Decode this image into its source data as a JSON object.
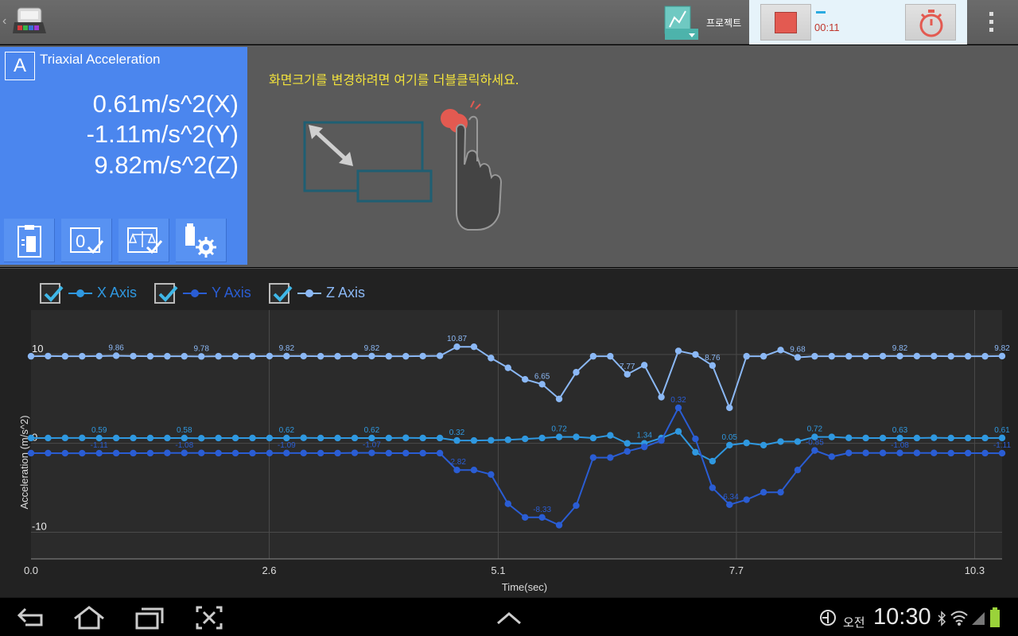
{
  "topbar": {
    "project_label": "프로젝트",
    "elapsed_time": "00:11",
    "icons": [
      "back-chevron-icon",
      "sensor-device-icon",
      "project-icon",
      "stop-icon",
      "stopwatch-icon",
      "overflow-menu-icon"
    ]
  },
  "sensor_card": {
    "letter": "A",
    "title": "Triaxial Acceleration",
    "readings": {
      "x": "0.61m/s^2(X)",
      "y": "-1.11m/s^2(Y)",
      "z": "9.82m/s^2(Z)"
    },
    "buttons": [
      "clipboard-icon",
      "zero-check-icon",
      "balance-check-icon",
      "sensor-settings-icon"
    ],
    "color": "#4b86ee"
  },
  "hint": {
    "text": "화면크기를 변경하려면 여기를 더블클릭하세요."
  },
  "legend": {
    "x_label": "X Axis",
    "y_label": "Y Axis",
    "z_label": "Z Axis"
  },
  "chart_data": {
    "type": "line",
    "xlabel": "Time(sec)",
    "ylabel": "Acceleration (m/s^2)",
    "xlim": [
      0,
      10.6
    ],
    "ylim": [
      -13,
      15
    ],
    "x_ticks": [
      "0.0",
      "2.6",
      "5.1",
      "7.7",
      "10.3"
    ],
    "x_tick_values": [
      0,
      2.6,
      5.1,
      7.7,
      10.3
    ],
    "y_ticks": [
      "10",
      "0",
      "-10"
    ],
    "y_tick_values": [
      10,
      0,
      -10
    ],
    "grid": true,
    "series": [
      {
        "name": "X Axis",
        "color": "#2f98e0",
        "values": [
          0.6,
          0.6,
          0.61,
          0.61,
          0.59,
          0.6,
          0.6,
          0.6,
          0.6,
          0.6,
          0.58,
          0.6,
          0.6,
          0.6,
          0.6,
          0.6,
          0.62,
          0.6,
          0.6,
          0.6,
          0.6,
          0.6,
          0.62,
          0.6,
          0.6,
          0.32,
          0.32,
          0.35,
          0.4,
          0.5,
          0.6,
          0.72,
          0.72,
          0.6,
          0.9,
          0.0,
          0.0,
          0.6,
          1.34,
          -1.0,
          -2.0,
          -0.2,
          0.05,
          -0.2,
          0.2,
          0.2,
          0.72,
          0.72,
          0.62,
          0.6,
          0.6,
          0.6,
          0.6,
          0.63,
          0.6,
          0.6,
          0.6,
          0.61
        ],
        "labels": {
          "4": "0.59",
          "9": "0.58",
          "15": "0.62",
          "20": "0.62",
          "25": "0.32",
          "31": "0.72",
          "36": "1.34",
          "41": "0.05",
          "46": "0.72",
          "51": "0.63",
          "57": "0.61"
        }
      },
      {
        "name": "Y Axis",
        "color": "#2a5dd4",
        "values": [
          -1.1,
          -1.1,
          -1.11,
          -1.11,
          -1.11,
          -1.1,
          -1.1,
          -1.1,
          -1.08,
          -1.08,
          -1.08,
          -1.1,
          -1.1,
          -1.1,
          -1.09,
          -1.09,
          -1.09,
          -1.1,
          -1.1,
          -1.07,
          -1.07,
          -1.1,
          -1.1,
          -1.1,
          -1.1,
          -3.0,
          -3.0,
          -3.5,
          -6.8,
          -8.33,
          -8.33,
          -9.2,
          -7.0,
          -1.6,
          -1.6,
          -0.9,
          -0.4,
          0.32,
          4.0,
          0.5,
          -5.0,
          -6.9,
          -6.34,
          -5.5,
          -5.5,
          -3.0,
          -0.8,
          -1.5,
          -1.08,
          -1.08,
          -1.08,
          -1.08,
          -1.08,
          -1.08,
          -1.1,
          -1.1,
          -1.1,
          -1.11
        ],
        "labels": {
          "4": "-1.11",
          "9": "-1.08",
          "15": "-1.09",
          "20": "-1.07",
          "25": "-2.82",
          "30": "-8.33",
          "38": "0.32",
          "41": "-6.34",
          "46": "-0.85",
          "51": "-1.08",
          "57": "-1.11"
        }
      },
      {
        "name": "Z Axis",
        "color": "#8bb8f5",
        "values": [
          9.8,
          9.82,
          9.8,
          9.8,
          9.82,
          9.86,
          9.82,
          9.8,
          9.8,
          9.8,
          9.78,
          9.8,
          9.8,
          9.8,
          9.82,
          9.82,
          9.82,
          9.8,
          9.8,
          9.82,
          9.82,
          9.8,
          9.8,
          9.82,
          9.85,
          10.87,
          10.87,
          9.6,
          8.5,
          7.2,
          6.65,
          5.0,
          8.0,
          9.8,
          9.8,
          7.77,
          8.8,
          5.2,
          10.4,
          10.0,
          8.76,
          4.0,
          9.8,
          9.8,
          10.5,
          9.68,
          9.8,
          9.8,
          9.8,
          9.8,
          9.82,
          9.82,
          9.82,
          9.82,
          9.8,
          9.8,
          9.8,
          9.82
        ],
        "labels": {
          "5": "9.86",
          "10": "9.78",
          "15": "9.82",
          "20": "9.82",
          "25": "10.87",
          "30": "6.65",
          "35": "7.77",
          "40": "8.76",
          "45": "9.68",
          "51": "9.82",
          "57": "9.82"
        }
      }
    ]
  },
  "navbar": {
    "icons": [
      "back-icon",
      "home-icon",
      "recent-apps-icon",
      "screenshot-icon",
      "up-chevron-icon",
      "data-saver-icon",
      "bluetooth-icon",
      "wifi-icon",
      "signal-icon",
      "battery-icon"
    ],
    "am_label": "오전",
    "clock": "10:30"
  }
}
